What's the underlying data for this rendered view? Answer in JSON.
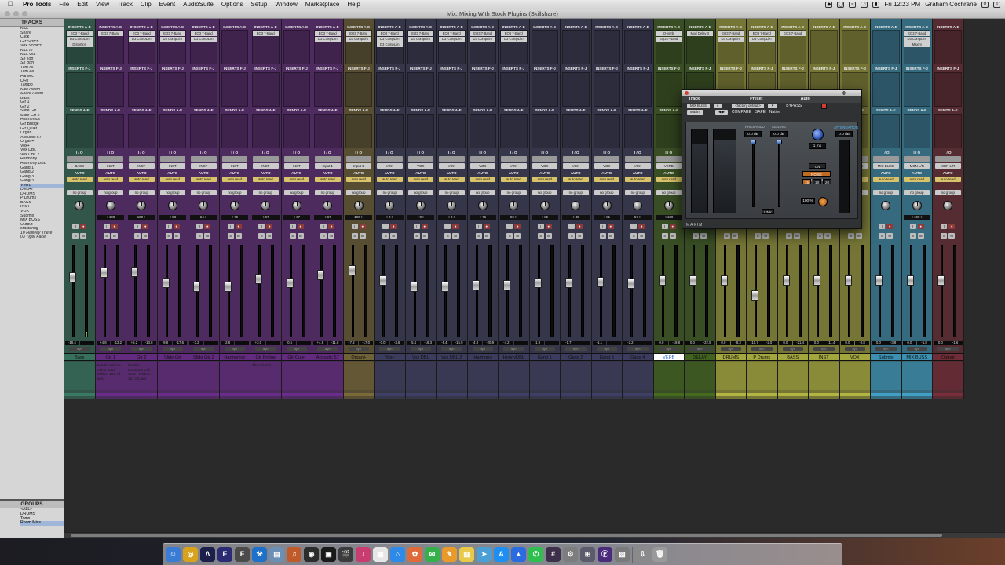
{
  "menubar": {
    "apple": "",
    "items": [
      "Pro Tools",
      "File",
      "Edit",
      "View",
      "Track",
      "Clip",
      "Event",
      "AudioSuite",
      "Options",
      "Setup",
      "Window",
      "Marketplace",
      "Help"
    ],
    "time": "Fri 12:23 PM",
    "user": "Graham Cochrane"
  },
  "window": {
    "title": "Mix: Mixing With Stock Plugins (Skillshare)"
  },
  "tracks_panel": {
    "header": "TRACKS",
    "items": [
      {
        "name": "Kick",
        "it": false
      },
      {
        "name": "Snare",
        "it": false
      },
      {
        "name": "Click",
        "it": false
      },
      {
        "name": "Gtr Scrtch",
        "it": true
      },
      {
        "name": "Vox Scratch",
        "it": true
      },
      {
        "name": "Kick In",
        "it": true
      },
      {
        "name": "Kick Out",
        "it": true
      },
      {
        "name": "Sn Top",
        "it": true
      },
      {
        "name": "Sn Btm",
        "it": true
      },
      {
        "name": "Tom Hi",
        "it": true
      },
      {
        "name": "Tom Lo",
        "it": true
      },
      {
        "name": "Fat Mic",
        "it": true
      },
      {
        "name": "OHs",
        "it": true
      },
      {
        "name": "Tambo",
        "it": true
      },
      {
        "name": "Kick Room",
        "it": true
      },
      {
        "name": "Snare Room",
        "it": true
      },
      {
        "name": "Bass",
        "it": false
      },
      {
        "name": "Gtr 1",
        "it": false
      },
      {
        "name": "Gtr 2",
        "it": false
      },
      {
        "name": "Slide Gtr",
        "it": false
      },
      {
        "name": "Slide Gtr 2",
        "it": false
      },
      {
        "name": "Harmonics",
        "it": false
      },
      {
        "name": "Gtr Bridge",
        "it": false
      },
      {
        "name": "Gtr Quiet",
        "it": false
      },
      {
        "name": "Organ",
        "it": false
      },
      {
        "name": "Acoustic 57",
        "it": false
      },
      {
        "name": "Organ+",
        "it": false
      },
      {
        "name": "Vox+",
        "it": false
      },
      {
        "name": "Vox DBL",
        "it": false
      },
      {
        "name": "Vox DBL 2",
        "it": false
      },
      {
        "name": "Harmony",
        "it": false
      },
      {
        "name": "Harmony DBL",
        "it": false
      },
      {
        "name": "Gang 1",
        "it": false
      },
      {
        "name": "Gang 2",
        "it": false
      },
      {
        "name": "Gang 3",
        "it": false
      },
      {
        "name": "Gang 4",
        "it": false
      },
      {
        "name": "VERB",
        "it": false,
        "sel": true
      },
      {
        "name": "DELAY",
        "it": false
      },
      {
        "name": "DRUMS",
        "it": false
      },
      {
        "name": "P Drums",
        "it": false
      },
      {
        "name": "BASS",
        "it": false
      },
      {
        "name": "INST",
        "it": false
      },
      {
        "name": "VOX",
        "it": false
      },
      {
        "name": "Submix",
        "it": false
      },
      {
        "name": "MIX BUSS",
        "it": false
      },
      {
        "name": "Output",
        "it": false
      },
      {
        "name": "Mastering",
        "it": true
      },
      {
        "name": "10 Hallway There",
        "it": true
      },
      {
        "name": "03 Tiger Face!",
        "it": true
      }
    ]
  },
  "groups_panel": {
    "header": "GROUPS",
    "items": [
      {
        "name": "<ALL>",
        "sel": false
      },
      {
        "name": "DRUMS",
        "sel": false
      },
      {
        "name": "Toms",
        "sel": false
      },
      {
        "name": "Room Mics",
        "sel": true
      }
    ]
  },
  "section_labels": {
    "inserts_ae": "INSERTS A-E",
    "inserts_fj": "INSERTS F-J",
    "sends_ae": "SENDS A-E",
    "io": "I / O",
    "auto": "AUTO",
    "dyn": "dyn"
  },
  "strips": [
    {
      "name": "Bass",
      "color": "#3a7a64",
      "ins": [
        "EQ3 7-Band",
        "D3 CompLim",
        "Distortion"
      ],
      "io1": "BASS",
      "io2": "auto read",
      "grp": "no group",
      "pan": "",
      "vol": "-18.4",
      "pk": "",
      "fader": 0.67,
      "meter": 0.05,
      "comment": ""
    },
    {
      "name": "Gtr 1",
      "color": "#6a2c8a",
      "ins": [
        "EQ3 7-Band"
      ],
      "io1": "INST",
      "io2": "auto read",
      "grp": "no group",
      "pan": "< 100",
      "vol": "+4.8",
      "pk": "-13.2",
      "fader": 0.72,
      "meter": 0.0,
      "comment": "Fender Deluxe with a 1x12 - Ribbon 121 off axis"
    },
    {
      "name": "Gtr 2",
      "color": "#6a2c8a",
      "ins": [
        "EQ3 7-Band",
        "D3 CompLim"
      ],
      "io1": "INST",
      "io2": "auto read",
      "grp": "no group",
      "pan": "100 >",
      "vol": "+5.2",
      "pk": "-13.8",
      "fader": 0.73,
      "meter": 0.0,
      "comment": "Fender Bassman with 4x10 - Ribbon 121 off axis"
    },
    {
      "name": "Slide Gtr",
      "color": "#6a2c8a",
      "ins": [
        "EQ3 7-Band",
        "D3 CompLim"
      ],
      "io1": "INST",
      "io2": "auto read",
      "grp": "no group",
      "pan": "< 53",
      "vol": "-9.8",
      "pk": "-17.6",
      "fader": 0.6,
      "meter": 0.0,
      "comment": ""
    },
    {
      "name": "Slide Gtr 2",
      "color": "#6a2c8a",
      "ins": [
        "EQ3 7-Band",
        "D3 CompLim"
      ],
      "io1": "INST",
      "io2": "auto read",
      "grp": "no group",
      "pan": "24 >",
      "vol": "-3.2",
      "pk": "",
      "fader": 0.55,
      "meter": 0.0,
      "comment": ""
    },
    {
      "name": "Harmonics",
      "color": "#6a2c8a",
      "ins": [],
      "io1": "INST",
      "io2": "auto read",
      "grp": "no group",
      "pan": "< 79",
      "vol": "-2.8",
      "pk": "",
      "fader": 0.55,
      "meter": 0.0,
      "comment": ""
    },
    {
      "name": "Gtr Bridge",
      "color": "#6a2c8a",
      "ins": [
        "EQ3 7-Band"
      ],
      "io1": "INST",
      "io2": "auto read",
      "grp": "no group",
      "pan": "< 67",
      "vol": "+3.0",
      "pk": "",
      "fader": 0.65,
      "meter": 0.0,
      "comment": "The Crunch"
    },
    {
      "name": "Gtr Quiet",
      "color": "#6a2c8a",
      "ins": [],
      "io1": "INST",
      "io2": "auto read",
      "grp": "no group",
      "pan": "< 67",
      "vol": "-0.5",
      "pk": "",
      "fader": 0.6,
      "meter": 0.0,
      "comment": ""
    },
    {
      "name": "Acoustic 57",
      "color": "#6a2c8a",
      "ins": [
        "EQ3 7-Band",
        "D3 CompLim"
      ],
      "io1": "Input 1",
      "io2": "auto read",
      "grp": "no group",
      "pan": "< 67",
      "vol": "+4.8",
      "pk": "-11.8",
      "fader": 0.7,
      "meter": 0.0,
      "comment": ""
    },
    {
      "name": "Organ+",
      "color": "#7a6a3a",
      "ins": [
        "EQ3 7-Band",
        "D3 CompLim"
      ],
      "io1": "Input 1",
      "io2": "auto read",
      "grp": "no group",
      "pan": "100 >",
      "vol": "+7.2",
      "pk": "-17.0",
      "fader": 0.75,
      "meter": 0.0,
      "comment": ""
    },
    {
      "name": "Vox+",
      "color": "#3f3f66",
      "ins": [
        "EQ3 7-Band",
        "D3 CompLim",
        "D3 CompLim"
      ],
      "io1": "VOX",
      "io2": "auto read",
      "grp": "no group",
      "pan": "< 0 >",
      "vol": "-0.0",
      "pk": "-2.6",
      "fader": 0.63,
      "meter": 0.0,
      "comment": ""
    },
    {
      "name": "Vox DBL",
      "color": "#3f3f66",
      "ins": [
        "EQ3 7-Band",
        "D3 CompLim"
      ],
      "io1": "VOX",
      "io2": "auto read",
      "grp": "no group",
      "pan": "< 0 >",
      "vol": "-5.4",
      "pk": "-18.3",
      "fader": 0.55,
      "meter": 0.0,
      "comment": ""
    },
    {
      "name": "Vox DBL 2",
      "color": "#3f3f66",
      "ins": [
        "EQ3 7-Band",
        "D3 CompLim"
      ],
      "io1": "VOX",
      "io2": "auto read",
      "grp": "no group",
      "pan": "< 0 >",
      "vol": "-5.4",
      "pk": "-15.9",
      "fader": 0.55,
      "meter": 0.0,
      "comment": ""
    },
    {
      "name": "Harmony",
      "color": "#3f3f66",
      "ins": [
        "EQ3 7-Band",
        "D3 CompLim"
      ],
      "io1": "VOX",
      "io2": "auto read",
      "grp": "no group",
      "pan": "< 76",
      "vol": "-4.3",
      "pk": "-20.9",
      "fader": 0.57,
      "meter": 0.0,
      "comment": ""
    },
    {
      "name": "HrmnyDBL",
      "color": "#3f3f66",
      "ins": [
        "EQ3 7-Band",
        "D3 CompLim"
      ],
      "io1": "VOX",
      "io2": "auto read",
      "grp": "no group",
      "pan": "90 >",
      "vol": "-4.2",
      "pk": "",
      "fader": 0.57,
      "meter": 0.0,
      "comment": ""
    },
    {
      "name": "Gang 1",
      "color": "#3f3f66",
      "ins": [],
      "io1": "VOX",
      "io2": "auto read",
      "grp": "no group",
      "pan": "< 85",
      "vol": "-1.9",
      "pk": "",
      "fader": 0.6,
      "meter": 0.0,
      "comment": ""
    },
    {
      "name": "Gang 2",
      "color": "#3f3f66",
      "ins": [],
      "io1": "VOX",
      "io2": "auto read",
      "grp": "no group",
      "pan": "< 49",
      "vol": "-1.7",
      "pk": "",
      "fader": 0.6,
      "meter": 0.0,
      "comment": ""
    },
    {
      "name": "Gang 3",
      "color": "#3f3f66",
      "ins": [],
      "io1": "VOX",
      "io2": "auto read",
      "grp": "no group",
      "pan": "< 81",
      "vol": "-1.1",
      "pk": "",
      "fader": 0.61,
      "meter": 0.0,
      "comment": ""
    },
    {
      "name": "Gang 4",
      "color": "#3f3f66",
      "ins": [],
      "io1": "VOX",
      "io2": "auto read",
      "grp": "no group",
      "pan": "57 >",
      "vol": "-2.2",
      "pk": "",
      "fader": 0.59,
      "meter": 0.0,
      "comment": ""
    },
    {
      "name": "VERB",
      "color": "#466b1f",
      "ins": [
        "D-Verb",
        "EQ3 7-Band"
      ],
      "io1": "VERB",
      "io2": "auto read",
      "grp": "no group",
      "pan": "< 100",
      "vol": "0.0",
      "pk": "-19.8",
      "fader": 0.63,
      "meter": 0.0,
      "comment": "",
      "sel": true
    },
    {
      "name": "DELAY",
      "color": "#466b1f",
      "ins": [
        "Mod Delay 3"
      ],
      "io1": "MIX BUSS",
      "io2": "auto read",
      "grp": "no group",
      "pan": "",
      "vol": "0.0",
      "pk": "-22.5",
      "fader": 0.63,
      "meter": 0.0,
      "comment": ""
    },
    {
      "name": "DRUMS",
      "color": "#b3b540",
      "ins": [
        "EQ3 7-Band",
        "D3 CompLim"
      ],
      "io1": "MIX BUSS",
      "io2": "auto read",
      "grp": "no group",
      "pan": "",
      "vol": "0.0",
      "pk": "-8.3",
      "fader": 0.63,
      "meter": 0.0,
      "comment": ""
    },
    {
      "name": "P Drums",
      "color": "#b3b540",
      "ins": [
        "EQ3 7-Band",
        "D3 CompLim"
      ],
      "io1": "MIX BUSS",
      "io2": "auto read",
      "grp": "no group",
      "pan": "",
      "vol": "-10.7",
      "pk": "-2.0",
      "fader": 0.45,
      "meter": 0.0,
      "comment": ""
    },
    {
      "name": "BASS",
      "color": "#b3b540",
      "ins": [
        "EQ3 7-Band"
      ],
      "io1": "MIX BUSS",
      "io2": "auto read",
      "grp": "no group",
      "pan": "",
      "vol": "0.0",
      "pk": "-21.4",
      "fader": 0.63,
      "meter": 0.0,
      "comment": ""
    },
    {
      "name": "INST",
      "color": "#b3b540",
      "ins": [],
      "io1": "MIX BUSS",
      "io2": "auto read",
      "grp": "no group",
      "pan": "",
      "vol": "0.0",
      "pk": "-11.4",
      "fader": 0.63,
      "meter": 0.0,
      "comment": ""
    },
    {
      "name": "VOX",
      "color": "#b3b540",
      "ins": [],
      "io1": "MIX BUSS",
      "io2": "auto read",
      "grp": "no group",
      "pan": "",
      "vol": "0.0",
      "pk": "-0.8",
      "fader": 0.63,
      "meter": 0.0,
      "comment": ""
    },
    {
      "name": "Submix",
      "color": "#3f9fc4",
      "ins": [],
      "io1": "MIX BUSS",
      "io2": "auto read",
      "grp": "no group",
      "pan": "",
      "vol": "0.0",
      "pk": "-3.8",
      "fader": 0.63,
      "meter": 0.0,
      "comment": ""
    },
    {
      "name": "MIX BUSS",
      "color": "#3f9fc4",
      "ins": [
        "EQ3 7-Band",
        "D3 CompLim",
        "Maxim"
      ],
      "io1": "MON L/R",
      "io2": "auto read",
      "grp": "no group",
      "pan": "< 100 >",
      "vol": "0.0",
      "pk": "-1.8",
      "fader": 0.63,
      "meter": 0.0,
      "comment": ""
    },
    {
      "name": "Output",
      "color": "#7a2d3a",
      "ins": [],
      "io1": "MON L/R",
      "io2": "auto read",
      "grp": "no group",
      "pan": "",
      "vol": "0.0",
      "pk": "-1.6",
      "fader": 0.63,
      "meter": 0.0,
      "comment": ""
    }
  ],
  "plugin": {
    "track_label": "Track",
    "preset_label": "Preset",
    "auto_label": "Auto",
    "track_value": "MIX BUSS",
    "track_slot": "c",
    "preset_value": "<factory default>",
    "plugin_name": "Maxim",
    "compare": "COMPARE",
    "safe": "SAFE",
    "bypass": "BYPASS",
    "native": "Native",
    "threshold_label": "THRESHOLD",
    "ceiling_label": "CEILING",
    "threshold_value": "0.0 dB",
    "ceiling_value": "0.0 dB",
    "release_value": "1 ms",
    "mix_value": "100 %",
    "attenuation_label": "ATTENUATION",
    "attenuation_value": "0.0 dB",
    "link": "LINK",
    "on": "ON",
    "noise_shaping": "NOISE SHAPING",
    "bits": [
      "16",
      "18",
      "20"
    ],
    "brand": "MAXIM"
  },
  "dock": {
    "icons": [
      "finder-icon",
      "chrome-icon",
      "avid-icon",
      "editor-icon",
      "final-cut-icon",
      "xcode-icon",
      "preview-icon",
      "guitar-icon",
      "capture-icon",
      "ilok-icon",
      "clapper-icon",
      "itunes-icon",
      "calendar-icon",
      "safari-icon",
      "photos-icon",
      "messages-icon",
      "pages-icon",
      "notes-icon",
      "maps-icon",
      "appstore-icon",
      "keynote-icon",
      "facetime-icon",
      "slack-icon",
      "settings-icon",
      "launchpad-icon",
      "protools-icon",
      "photo-icon",
      "downloads-icon",
      "trash-icon"
    ]
  }
}
